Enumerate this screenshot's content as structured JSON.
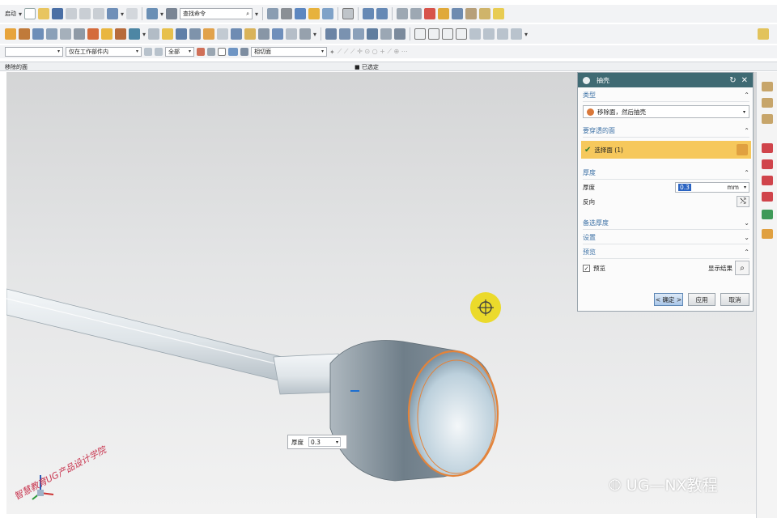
{
  "toolbar": {
    "start_label": "启动",
    "search_placeholder": "查找命令",
    "filter_scope": "仅在工作部件内",
    "filter_all": "全部",
    "snap_mode": "相切面"
  },
  "status": {
    "left_prompt": "移除的面",
    "selection_count": "已选定"
  },
  "dialog": {
    "title": "抽壳",
    "type_section": "类型",
    "type_value": "移除面，然后抽壳",
    "faces_section": "要穿透的面",
    "faces_selected": "选择面 (1)",
    "thickness_section": "厚度",
    "thickness_label": "厚度",
    "thickness_value": "0.3",
    "thickness_unit": "mm",
    "reverse_label": "反向",
    "alt_thickness_section": "备选厚度",
    "settings_section": "设置",
    "preview_section": "预览",
    "preview_checkbox": "预览",
    "show_result": "显示结果",
    "ok": "< 确定 >",
    "apply": "应用",
    "cancel": "取消"
  },
  "viewport": {
    "float_label": "厚度",
    "float_value": "0.3",
    "watermark": "智慧教育UG产品设计学院",
    "brand": "UG—NX教程"
  },
  "colors": {
    "dialog_title_bg": "#3f6a73",
    "highlight": "#f6c85c",
    "cursor": "#ecd91c",
    "model_edge": "#e3833a"
  }
}
